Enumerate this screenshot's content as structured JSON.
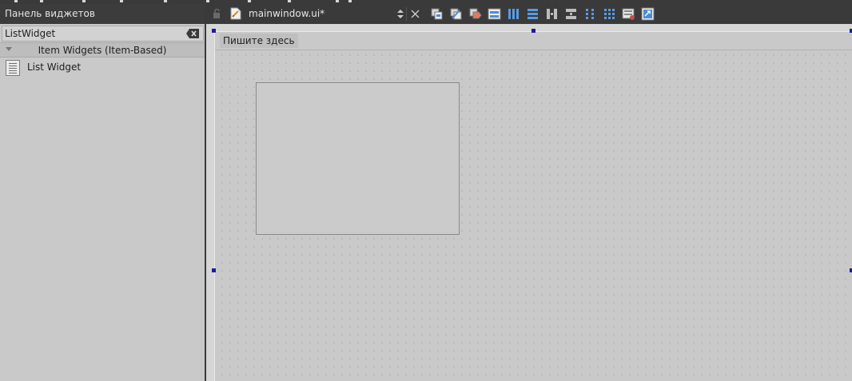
{
  "widget_box": {
    "title": "Панель виджетов",
    "filter": {
      "value": "ListWidget",
      "clear_icon": "clear-filter-icon"
    },
    "category": {
      "label": "Item Widgets (Item-Based)",
      "expanded": true
    },
    "items": [
      {
        "label": "List Widget",
        "icon": "list-widget-icon"
      }
    ]
  },
  "editor": {
    "file_name": "mainwindow.ui*",
    "toolbar": [
      "edit-widgets-icon",
      "edit-signals-slots-icon",
      "edit-buddies-icon",
      "edit-tab-order-icon",
      "layout-horizontal-icon",
      "layout-vertical-icon",
      "layout-horizontal-splitter-icon",
      "layout-vertical-splitter-icon",
      "layout-form-icon",
      "layout-grid-icon",
      "break-layout-icon",
      "adjust-size-icon"
    ]
  },
  "form": {
    "menu_placeholder": "Пишите здесь"
  },
  "colors": {
    "panel_bg": "#c9c9c9",
    "dark_bar": "#3a3a3a",
    "selection_handle": "#1c1c9c",
    "toolbar_accent": "#4a8fd8"
  }
}
